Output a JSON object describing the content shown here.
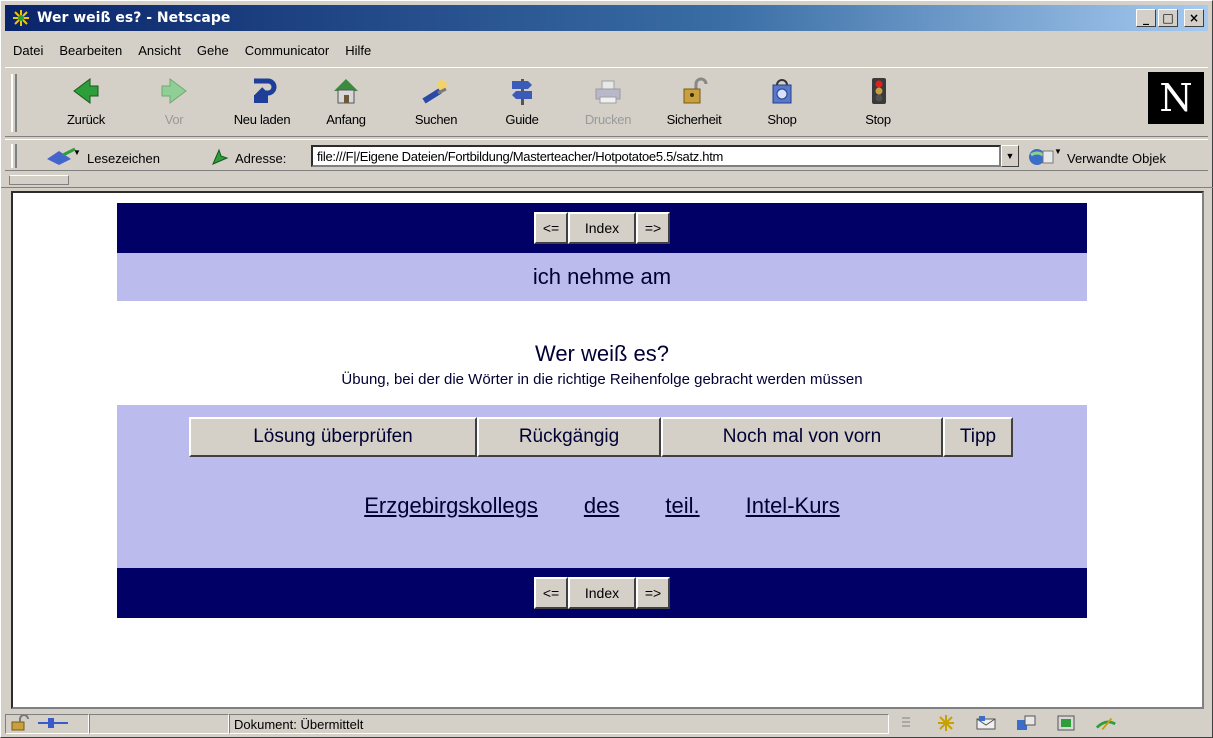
{
  "window": {
    "title": "Wer weiß es? - Netscape",
    "minimize": "_",
    "maximize": "□",
    "close": "×"
  },
  "menu": [
    {
      "label": "Datei"
    },
    {
      "label": "Bearbeiten"
    },
    {
      "label": "Ansicht"
    },
    {
      "label": "Gehe"
    },
    {
      "label": "Communicator"
    },
    {
      "label": "Hilfe"
    }
  ],
  "toolbar": {
    "back": "Zurück",
    "forward": "Vor",
    "reload": "Neu laden",
    "home": "Anfang",
    "search": "Suchen",
    "guide": "Guide",
    "print": "Drucken",
    "security": "Sicherheit",
    "shop": "Shop",
    "stop": "Stop",
    "logo": "N"
  },
  "location": {
    "bookmarks_label": "Lesezeichen",
    "address_label": "Adresse:",
    "url": "file:///F|/Eigene Dateien/Fortbildung/Masterteacher/Hotpotatoe5.5/satz.htm",
    "related_label": "Verwandte Objek"
  },
  "page": {
    "nav": {
      "prev": "<=",
      "index": "Index",
      "next": "=>"
    },
    "prompt": "ich nehme am",
    "title": "Wer weiß es?",
    "subtitle": "Übung, bei der die Wörter in die richtige Reihenfolge gebracht werden müssen",
    "buttons": {
      "check": "Lösung überprüfen",
      "undo": "Rückgängig",
      "restart": "Noch mal von vorn",
      "hint": "Tipp"
    },
    "words": [
      "Erzgebirgskollegs",
      "des",
      "teil.",
      "Intel-Kurs"
    ]
  },
  "status": {
    "text": "Dokument: Übermittelt"
  },
  "colors": {
    "navbar": "#000066",
    "panel": "#bbbbee",
    "titlebar_start": "#0a246a"
  }
}
